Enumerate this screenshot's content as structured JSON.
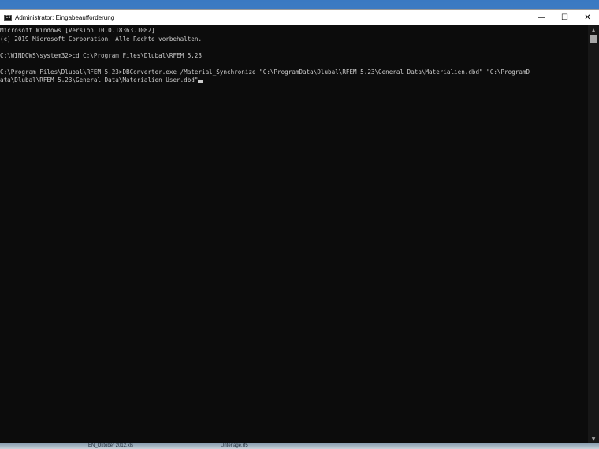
{
  "window": {
    "title": "Administrator: Eingabeaufforderung",
    "icon": "cmd-icon",
    "controls": {
      "minimize": "—",
      "maximize": "☐",
      "close": "✕"
    }
  },
  "console": {
    "lines": [
      "Microsoft Windows [Version 10.0.18363.1082]",
      "(c) 2019 Microsoft Corporation. Alle Rechte vorbehalten.",
      "",
      "C:\\WINDOWS\\system32>cd C:\\Program Files\\Dlubal\\RFEM 5.23",
      "",
      "C:\\Program Files\\Dlubal\\RFEM 5.23>DBConverter.exe /Material_Synchronize \"C:\\ProgramData\\Dlubal\\RFEM 5.23\\General Data\\Materialien.dbd\" \"C:\\ProgramD",
      "ata\\Dlubal\\RFEM 5.23\\General Data\\Materialien_User.dbd\""
    ]
  },
  "scrollbar": {
    "up_arrow": "▲",
    "down_arrow": "▼"
  },
  "taskbar": {
    "item1": "EN_Oktober 2012.xls",
    "item2": "Unterlage.rf5"
  }
}
